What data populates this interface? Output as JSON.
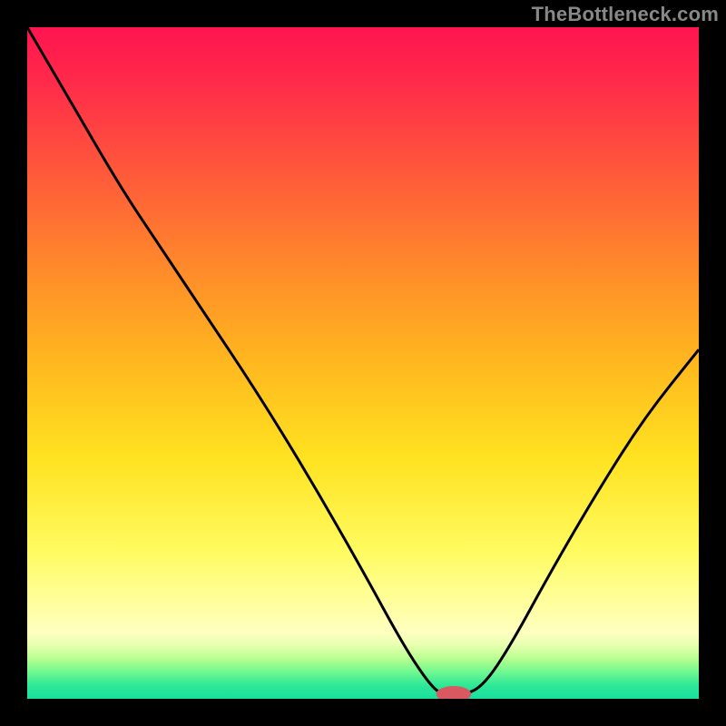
{
  "watermark": "TheBottleneck.com",
  "colors": {
    "frame": "#000000",
    "curve": "#000000",
    "marker": "#d85a60"
  },
  "chart_data": {
    "type": "line",
    "title": "",
    "xlabel": "",
    "ylabel": "",
    "xlim": [
      0,
      100
    ],
    "ylim": [
      0,
      100
    ],
    "curve": [
      {
        "x": 0,
        "y": 100
      },
      {
        "x": 7,
        "y": 88
      },
      {
        "x": 14,
        "y": 76
      },
      {
        "x": 20,
        "y": 67
      },
      {
        "x": 26,
        "y": 58
      },
      {
        "x": 34,
        "y": 46
      },
      {
        "x": 42,
        "y": 33
      },
      {
        "x": 50,
        "y": 19
      },
      {
        "x": 56,
        "y": 8
      },
      {
        "x": 60,
        "y": 2
      },
      {
        "x": 62,
        "y": 0.5
      },
      {
        "x": 65,
        "y": 0.5
      },
      {
        "x": 68,
        "y": 2
      },
      {
        "x": 72,
        "y": 8
      },
      {
        "x": 78,
        "y": 19
      },
      {
        "x": 85,
        "y": 31
      },
      {
        "x": 92,
        "y": 42
      },
      {
        "x": 100,
        "y": 52
      }
    ],
    "marker": {
      "x": 63.5,
      "y": 0.7,
      "rx": 2.6,
      "ry": 1.2
    },
    "legend": null,
    "grid": false
  }
}
